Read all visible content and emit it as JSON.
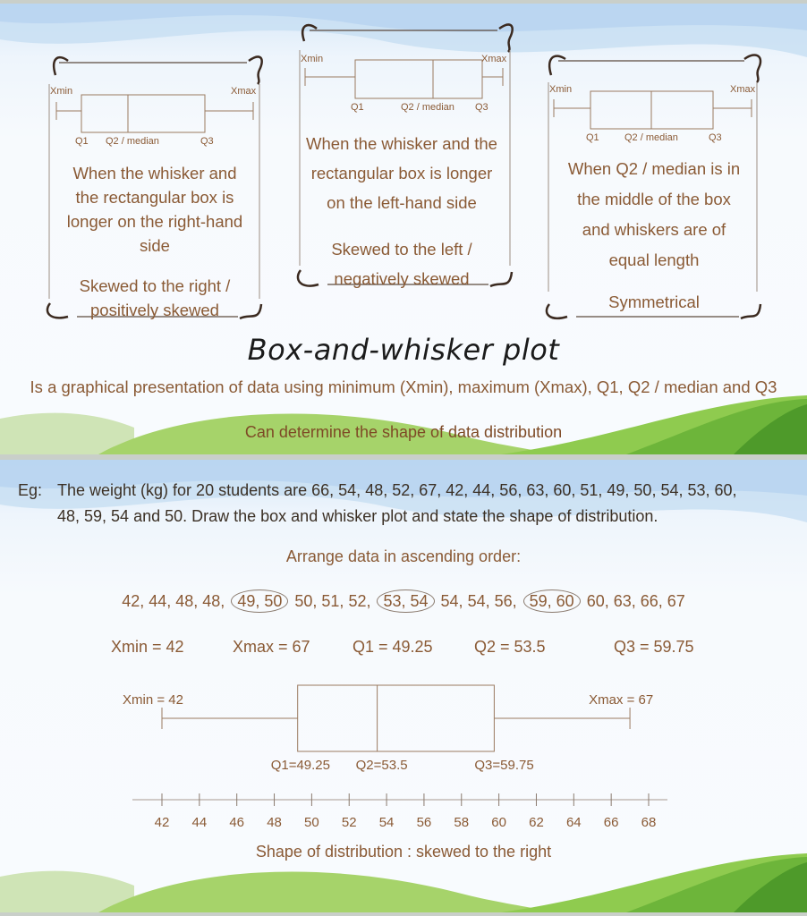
{
  "slide1": {
    "cards": [
      {
        "id": "right-skew",
        "mini_plot": {
          "xmin_label": "Xmin",
          "xmax_label": "Xmax",
          "q1_label": "Q1",
          "q2_label": "Q2 / median",
          "q3_label": "Q3"
        },
        "description_lines": [
          "When the whisker and",
          "the rectangular box is",
          "longer on the right-hand",
          "side"
        ],
        "shape_lines": [
          "Skewed to the right /",
          "positively skewed"
        ]
      },
      {
        "id": "left-skew",
        "mini_plot": {
          "xmin_label": "Xmin",
          "xmax_label": "Xmax",
          "q1_label": "Q1",
          "q2_label": "Q2 / median",
          "q3_label": "Q3"
        },
        "description_lines": [
          "When the whisker and the",
          "rectangular box is longer",
          "on the left-hand side"
        ],
        "shape_lines": [
          "Skewed to the left /",
          "negatively skewed"
        ]
      },
      {
        "id": "symmetrical",
        "mini_plot": {
          "xmin_label": "Xmin",
          "xmax_label": "Xmax",
          "q1_label": "Q1",
          "q2_label": "Q2 / median",
          "q3_label": "Q3"
        },
        "description_lines": [
          "When Q2 / median is in",
          "the middle of the box",
          "and whiskers are of",
          "equal length"
        ],
        "shape_lines": [
          "Symmetrical"
        ]
      }
    ],
    "title": "Box-and-whisker plot",
    "subtitle": "Is a graphical presentation of data using minimum (Xmin), maximum (Xmax), Q1, Q2 / median and Q3",
    "note": "Can determine the shape of data distribution"
  },
  "slide2": {
    "eg_label": "Eg:",
    "question_line1": "The weight (kg) for 20 students are 66, 54, 48, 52, 67, 42, 44, 56, 63, 60, 51, 49, 50, 54, 53, 60,",
    "question_line2": "48, 59, 54 and 50. Draw the box and whisker plot and state the shape of distribution.",
    "arrange_label": "Arrange data in ascending order:",
    "sorted_data": [
      42,
      44,
      48,
      48,
      49,
      50,
      50,
      51,
      52,
      53,
      54,
      54,
      54,
      56,
      59,
      60,
      60,
      63,
      66,
      67
    ],
    "circled_pairs": [
      [
        4,
        5
      ],
      [
        9,
        10
      ],
      [
        14,
        15
      ]
    ],
    "stats": {
      "xmin": "Xmin = 42",
      "xmax": "Xmax = 67",
      "q1": "Q1 = 49.25",
      "q2": "Q2 = 53.5",
      "q3": "Q3 = 59.75"
    },
    "conclusion": "Shape of distribution : skewed to the right"
  },
  "chart_data": {
    "type": "boxplot",
    "title": "",
    "xlabel": "",
    "xmin": 42,
    "q1": 49.25,
    "median": 53.5,
    "q3": 59.75,
    "xmax": 67,
    "labels": {
      "xmin": "Xmin = 42",
      "xmax": "Xmax = 67",
      "q1": "Q1=49.25",
      "q2": "Q2=53.5",
      "q3": "Q3=59.75"
    },
    "axis_ticks": [
      42,
      44,
      46,
      48,
      50,
      52,
      54,
      56,
      58,
      60,
      62,
      64,
      66,
      68
    ],
    "xlim": [
      42,
      68
    ],
    "grid": false
  },
  "colors": {
    "text_brown": "#8a5a35",
    "line_brown": "#9a7a60",
    "dark_text": "#1b1b1b",
    "hill_green": "#7cc43a"
  }
}
